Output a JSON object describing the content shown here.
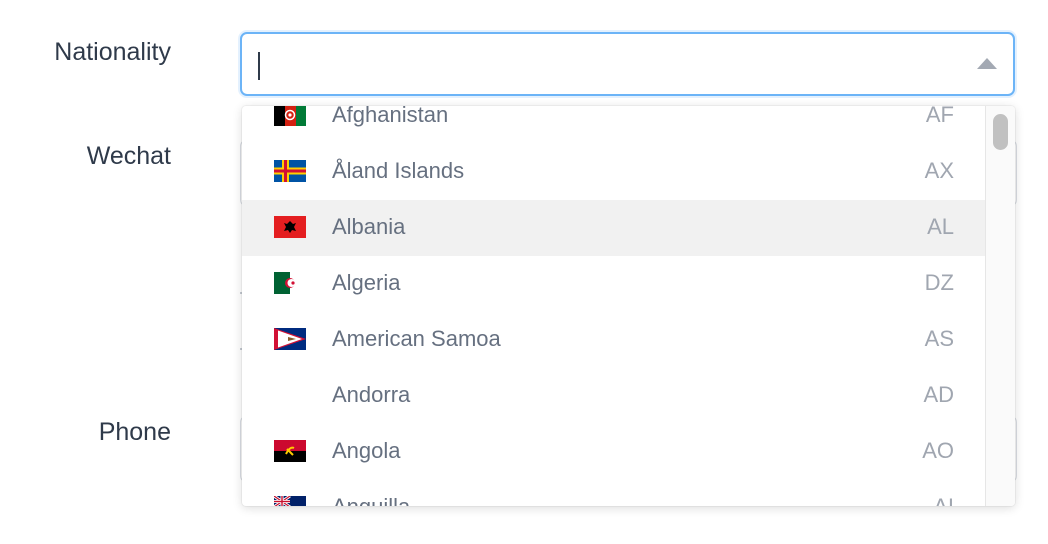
{
  "form": {
    "nationality_label": "Nationality",
    "wechat_label": "Wechat",
    "phone_label": "Phone",
    "nationality_value": ""
  },
  "dropdown": {
    "options": [
      {
        "name": "Afghanistan",
        "code": "AF",
        "flag": "af-flag-icon"
      },
      {
        "name": "Åland Islands",
        "code": "AX",
        "flag": "ax-flag-icon"
      },
      {
        "name": "Albania",
        "code": "AL",
        "flag": "al-flag-icon",
        "hovered": true
      },
      {
        "name": "Algeria",
        "code": "DZ",
        "flag": "dz-flag-icon"
      },
      {
        "name": "American Samoa",
        "code": "AS",
        "flag": "as-flag-icon"
      },
      {
        "name": "Andorra",
        "code": "AD",
        "flag": ""
      },
      {
        "name": "Angola",
        "code": "AO",
        "flag": "ao-flag-icon"
      },
      {
        "name": "Anguilla",
        "code": "AI",
        "flag": "ai-flag-icon"
      }
    ]
  },
  "colors": {
    "focus_border": "#6cb4f7",
    "hover_row": "#f1f1f1",
    "label_text": "#2f3a4a",
    "option_text": "#667080",
    "code_text": "#a0a6b0"
  }
}
